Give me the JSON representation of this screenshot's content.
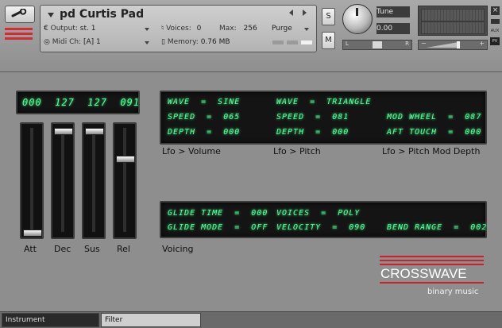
{
  "header": {
    "instrument_name": "pd Curtis Pad",
    "output_label": "Output:",
    "output_value": "st. 1",
    "voices_label": "Voices:",
    "voices_value": "0",
    "max_label": "Max:",
    "max_value": "256",
    "purge_label": "Purge",
    "midi_label": "Midi Ch:",
    "midi_value": "[A]  1",
    "memory_label": "Memory:",
    "memory_value": "0.76 MB",
    "solo_label": "S",
    "mute_label": "M",
    "tune_label": "Tune",
    "tune_value": "0.00",
    "pan_left": "L",
    "pan_right": "R",
    "vol_minus": "−",
    "vol_plus": "+",
    "aux_label": "AUX",
    "pv_label": "PV"
  },
  "envelope": {
    "display": "000  127  127  091",
    "labels": [
      "Att",
      "Dec",
      "Sus",
      "Rel"
    ],
    "values": [
      0,
      127,
      127,
      91
    ]
  },
  "lfo": {
    "volume": {
      "wave": "WAVE  =  SINE",
      "speed": "SPEED  =  065",
      "depth": "DEPTH  =  000"
    },
    "pitch": {
      "wave": "WAVE  =  TRIANGLE",
      "speed": "SPEED  =  081",
      "depth": "DEPTH  =  000"
    },
    "mod": {
      "wheel": "MOD WHEEL  =  087",
      "aft": "AFT TOUCH  =  000"
    },
    "labels": [
      "Lfo > Volume",
      "Lfo > Pitch",
      "Lfo > Pitch Mod Depth"
    ]
  },
  "voicing": {
    "glide_time": "GLIDE TIME  =  000",
    "glide_mode": "GLIDE MODE  =  OFF",
    "voices": "VOICES  =  POLY",
    "velocity": "VELOCITY  =  090",
    "bend_range": "BEND RANGE  =  002",
    "label": "Voicing"
  },
  "brand": {
    "name": "CROSSWAVE",
    "sub": "binary music",
    "color": "#c8222c"
  },
  "footer": {
    "tabs": [
      "Instrument",
      "Filter"
    ]
  }
}
